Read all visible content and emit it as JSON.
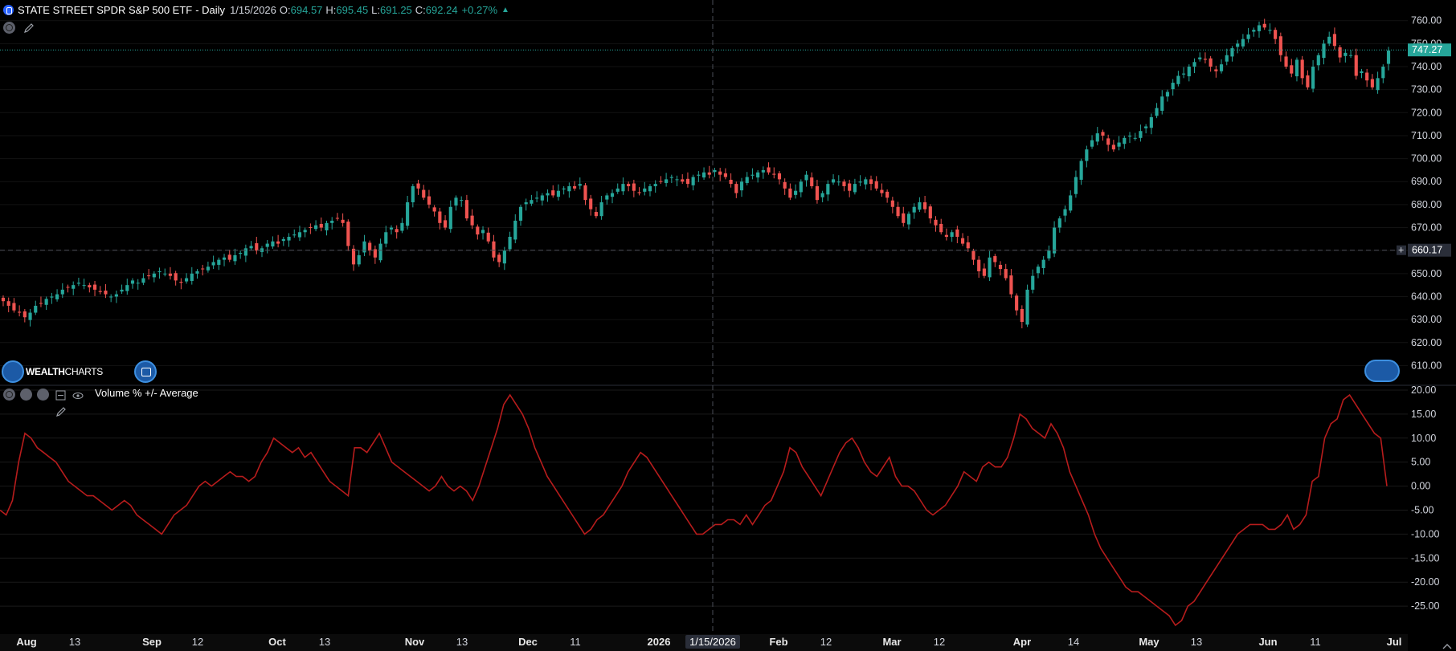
{
  "header": {
    "title": "STATE STREET SPDR S&P 500 ETF",
    "interval": "- Daily",
    "date": "1/15/2026",
    "open_label": "O:",
    "open": "694.57",
    "high_label": "H:",
    "high": "695.45",
    "low_label": "L:",
    "low": "691.25",
    "close_label": "C:",
    "close": "692.24",
    "change": "+0.27%"
  },
  "logo": {
    "bold": "WEALTH",
    "light": "CHARTS"
  },
  "indicator": {
    "title": "Volume % +/- Average"
  },
  "colors": {
    "up": "#26a69a",
    "down": "#ef5350",
    "line": "#b71c1c",
    "last_price": "#26a69a",
    "background": "#000000"
  },
  "chart_data": [
    {
      "type": "candlestick",
      "title": "STATE STREET SPDR S&P 500 ETF",
      "price_axis_ticks": [
        "760.00",
        "750.00",
        "740.00",
        "730.00",
        "720.00",
        "710.00",
        "700.00",
        "690.00",
        "680.00",
        "670.00",
        "660.00",
        "650.00",
        "640.00",
        "630.00",
        "620.00",
        "610.00"
      ],
      "ylim": [
        607,
        762
      ],
      "last_price_label": "747.27",
      "crosshair_price_label": "660.17",
      "crosshair_date_label": "1/15/2026",
      "x_tick_labels": [
        "Aug",
        "13",
        "Sep",
        "12",
        "Oct",
        "13",
        "Nov",
        "13",
        "Dec",
        "11",
        "2026",
        "1/15/2026",
        "Feb",
        "12",
        "Mar",
        "12",
        "Apr",
        "14",
        "May",
        "13",
        "Jun",
        "11",
        "Jul"
      ],
      "series_close": [
        638,
        636,
        634,
        633,
        631,
        633,
        636,
        637,
        639,
        640,
        641,
        643,
        644,
        645,
        646,
        645,
        644,
        643,
        642,
        641,
        640,
        641,
        643,
        645,
        647,
        646,
        648,
        649,
        650,
        651,
        650,
        649,
        647,
        646,
        648,
        650,
        651,
        652,
        653,
        655,
        656,
        657,
        656,
        658,
        659,
        661,
        662,
        660,
        661,
        663,
        664,
        663,
        665,
        666,
        667,
        668,
        669,
        670,
        671,
        670,
        672,
        673,
        674,
        672,
        662,
        654,
        658,
        664,
        660,
        657,
        663,
        668,
        670,
        668,
        672,
        681,
        688,
        687,
        683,
        680,
        677,
        672,
        670,
        679,
        683,
        682,
        674,
        671,
        667,
        669,
        664,
        657,
        655,
        660,
        666,
        673,
        679,
        681,
        682,
        683,
        684,
        685,
        684,
        686,
        687,
        688,
        687,
        689,
        682,
        678,
        675,
        681,
        684,
        685,
        687,
        689,
        688,
        686,
        685,
        687,
        688,
        689,
        690,
        691,
        692,
        691,
        690,
        689,
        692,
        693,
        694,
        693,
        695,
        693,
        692,
        689,
        685,
        690,
        692,
        693,
        694,
        695,
        694,
        693,
        691,
        687,
        683,
        686,
        690,
        693,
        688,
        682,
        685,
        689,
        691,
        690,
        688,
        686,
        689,
        690,
        691,
        689,
        687,
        685,
        683,
        679,
        675,
        672,
        676,
        679,
        681,
        678,
        674,
        671,
        668,
        666,
        668,
        666,
        663,
        661,
        656,
        651,
        649,
        657,
        655,
        652,
        648,
        641,
        634,
        629,
        643,
        649,
        653,
        656,
        660,
        670,
        674,
        678,
        684,
        692,
        699,
        704,
        708,
        711,
        710,
        706,
        704,
        707,
        709,
        710,
        709,
        712,
        714,
        718,
        722,
        727,
        729,
        733,
        736,
        737,
        740,
        742,
        744,
        743,
        740,
        738,
        741,
        745,
        748,
        750,
        752,
        754,
        756,
        758,
        757,
        756,
        752,
        745,
        740,
        737,
        743,
        735,
        731,
        740,
        745,
        750,
        753,
        749,
        744,
        746,
        745,
        736,
        738,
        734,
        731,
        735,
        740,
        747
      ],
      "series_volume_pct": [
        -5,
        -6,
        -3,
        5,
        11,
        10,
        8,
        7,
        6,
        5,
        3,
        1,
        0,
        -1,
        -2,
        -2,
        -3,
        -4,
        -5,
        -4,
        -3,
        -4,
        -6,
        -7,
        -8,
        -9,
        -10,
        -8,
        -6,
        -5,
        -4,
        -2,
        0,
        1,
        0,
        1,
        2,
        3,
        2,
        2,
        1,
        2,
        5,
        7,
        10,
        9,
        8,
        7,
        8,
        6,
        7,
        5,
        3,
        1,
        0,
        -1,
        -2,
        8,
        8,
        7,
        9,
        11,
        8,
        5,
        4,
        3,
        2,
        1,
        0,
        -1,
        0,
        2,
        0,
        -1,
        0,
        -1,
        -3,
        0,
        4,
        8,
        12,
        17,
        19,
        17,
        15,
        12,
        8,
        5,
        2,
        0,
        -2,
        -4,
        -6,
        -8,
        -10,
        -9,
        -7,
        -6,
        -4,
        -2,
        0,
        3,
        5,
        7,
        6,
        4,
        2,
        0,
        -2,
        -4,
        -6,
        -8,
        -10,
        -10,
        -9,
        -8,
        -8,
        -7,
        -7,
        -8,
        -6,
        -8,
        -6,
        -4,
        -3,
        0,
        3,
        8,
        7,
        4,
        2,
        0,
        -2,
        1,
        4,
        7,
        9,
        10,
        8,
        5,
        3,
        2,
        4,
        6,
        2,
        0,
        0,
        -1,
        -3,
        -5,
        -6,
        -5,
        -4,
        -2,
        0,
        3,
        2,
        1,
        4,
        5,
        4,
        4,
        6,
        10,
        15,
        14,
        12,
        11,
        10,
        13,
        11,
        8,
        3,
        0,
        -3,
        -6,
        -10,
        -13,
        -15,
        -17,
        -19,
        -21,
        -22,
        -22,
        -23,
        -24,
        -25,
        -26,
        -27,
        -29,
        -28,
        -25,
        -24,
        -22,
        -20,
        -18,
        -16,
        -14,
        -12,
        -10,
        -9,
        -8,
        -8,
        -8,
        -9,
        -9,
        -8,
        -6,
        -9,
        -8,
        -6,
        1,
        2,
        10,
        13,
        14,
        18,
        19,
        17,
        15,
        13,
        11,
        10,
        0
      ],
      "series_name": "Volume % +/- Average",
      "volume_axis_ticks": [
        "20.00",
        "15.00",
        "10.00",
        "5.00",
        "0.00",
        "-5.00",
        "-10.00",
        "-15.00",
        "-20.00",
        "-25.00"
      ],
      "volume_ylim": [
        -30.5,
        20
      ]
    }
  ]
}
